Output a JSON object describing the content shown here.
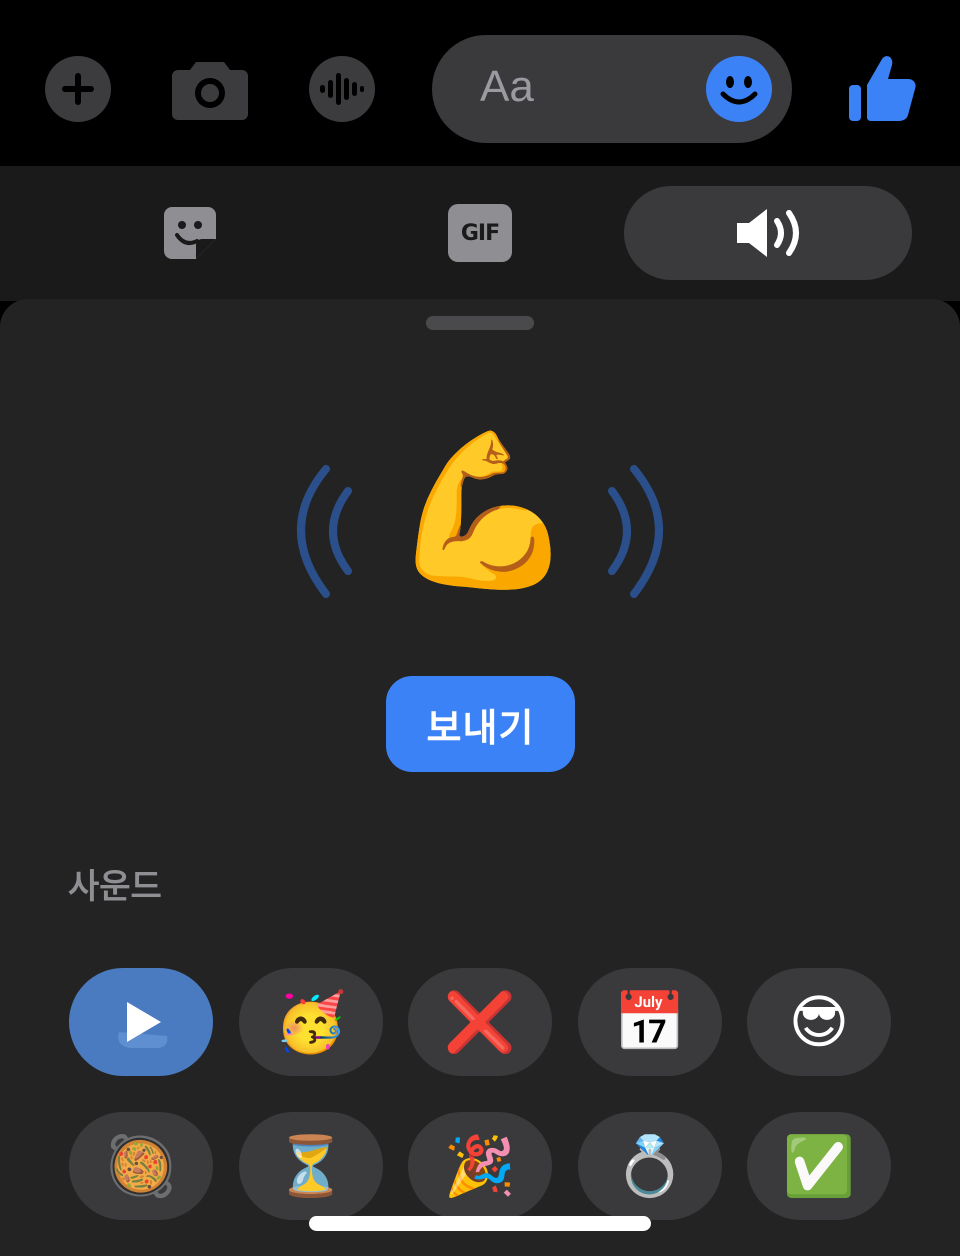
{
  "composer": {
    "placeholder": "Aa",
    "buttons": [
      "plus-icon",
      "camera-icon",
      "voice-icon",
      "emoji-icon",
      "thumbs-up-icon"
    ],
    "accent_color": "#3b82f6"
  },
  "tabs": {
    "items": [
      {
        "name": "sticker-icon",
        "label": ""
      },
      {
        "name": "gif",
        "label": "GIF"
      },
      {
        "name": "sound-icon",
        "label": ""
      }
    ],
    "active_index": 2
  },
  "preview": {
    "emoji": "💪",
    "send_label": "보내기"
  },
  "sounds": {
    "section_label": "사운드",
    "row1": [
      "▶",
      "🥳",
      "❌",
      "📅",
      "😎"
    ],
    "row2": [
      "🥘",
      "⏳",
      "🎉",
      "💍",
      "✅"
    ],
    "active_index": 0
  }
}
